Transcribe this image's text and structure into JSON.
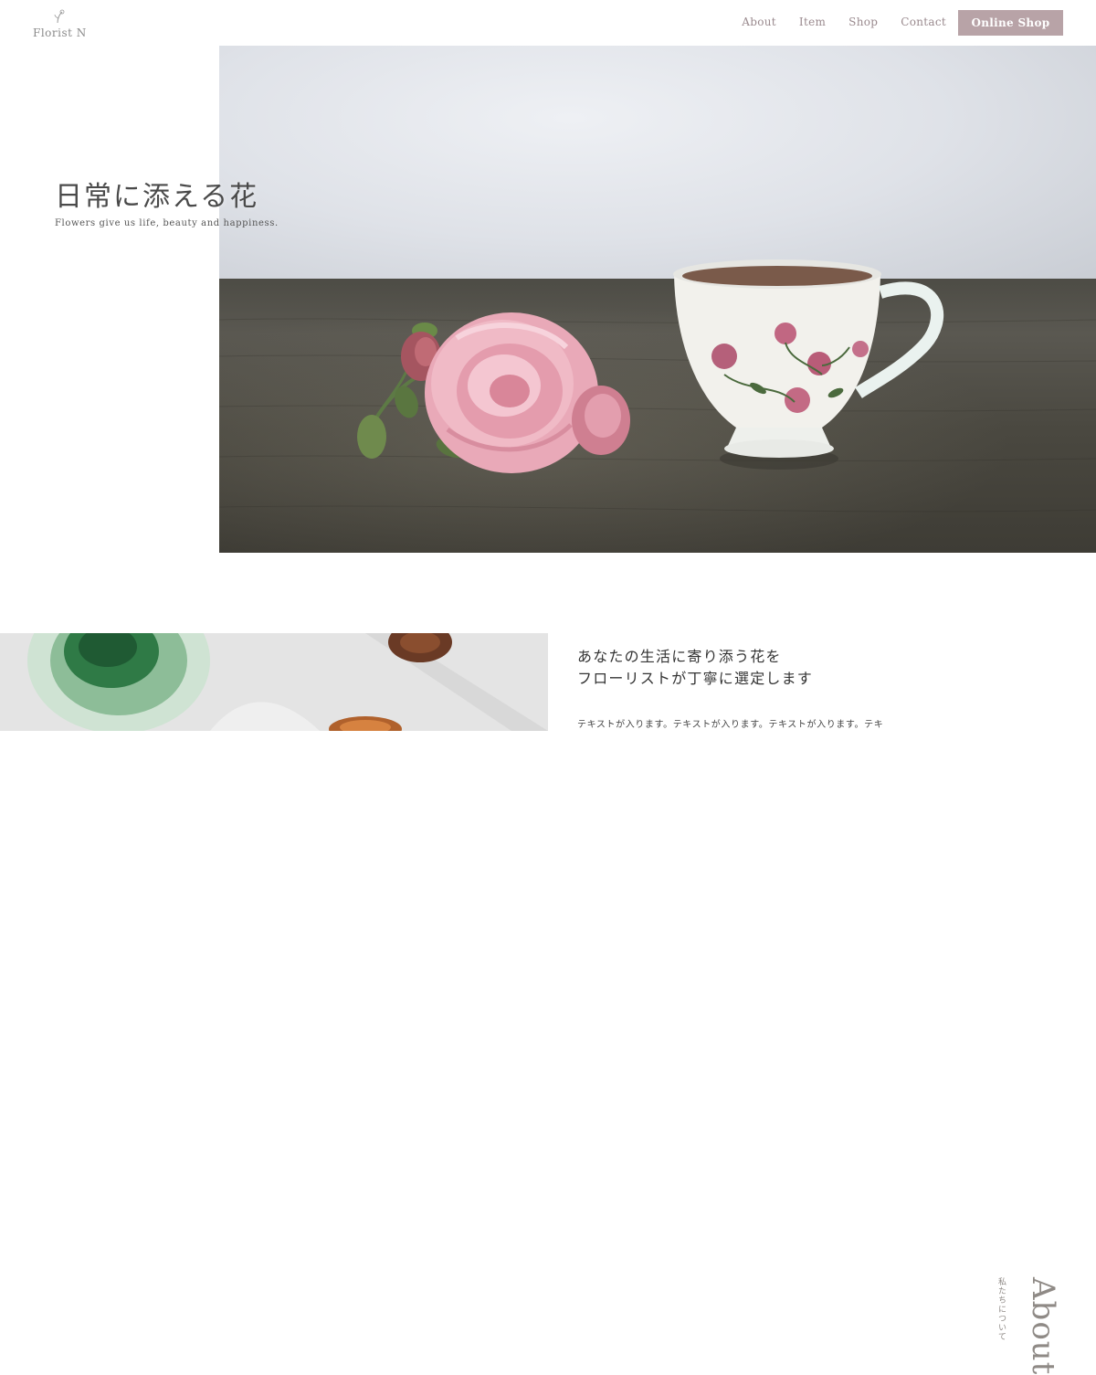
{
  "header": {
    "logo_text": "Florist N",
    "nav": [
      "About",
      "Item",
      "Shop",
      "Contact"
    ],
    "cta": "Online Shop"
  },
  "hero": {
    "title": "日常に添える花",
    "subtitle": "Flowers give us life, beauty and happiness."
  },
  "about": {
    "vertical_title": "About",
    "vertical_subtitle": "私たちについて",
    "heading_line1": "あなたの生活に寄り添う花を",
    "heading_line2": "フローリストが丁寧に選定します",
    "body": "テキストが入ります。テキストが入ります。テキストが入ります。テキ"
  },
  "colors": {
    "accent": "#b8a3a7",
    "nav_text": "#9a8a8e"
  }
}
